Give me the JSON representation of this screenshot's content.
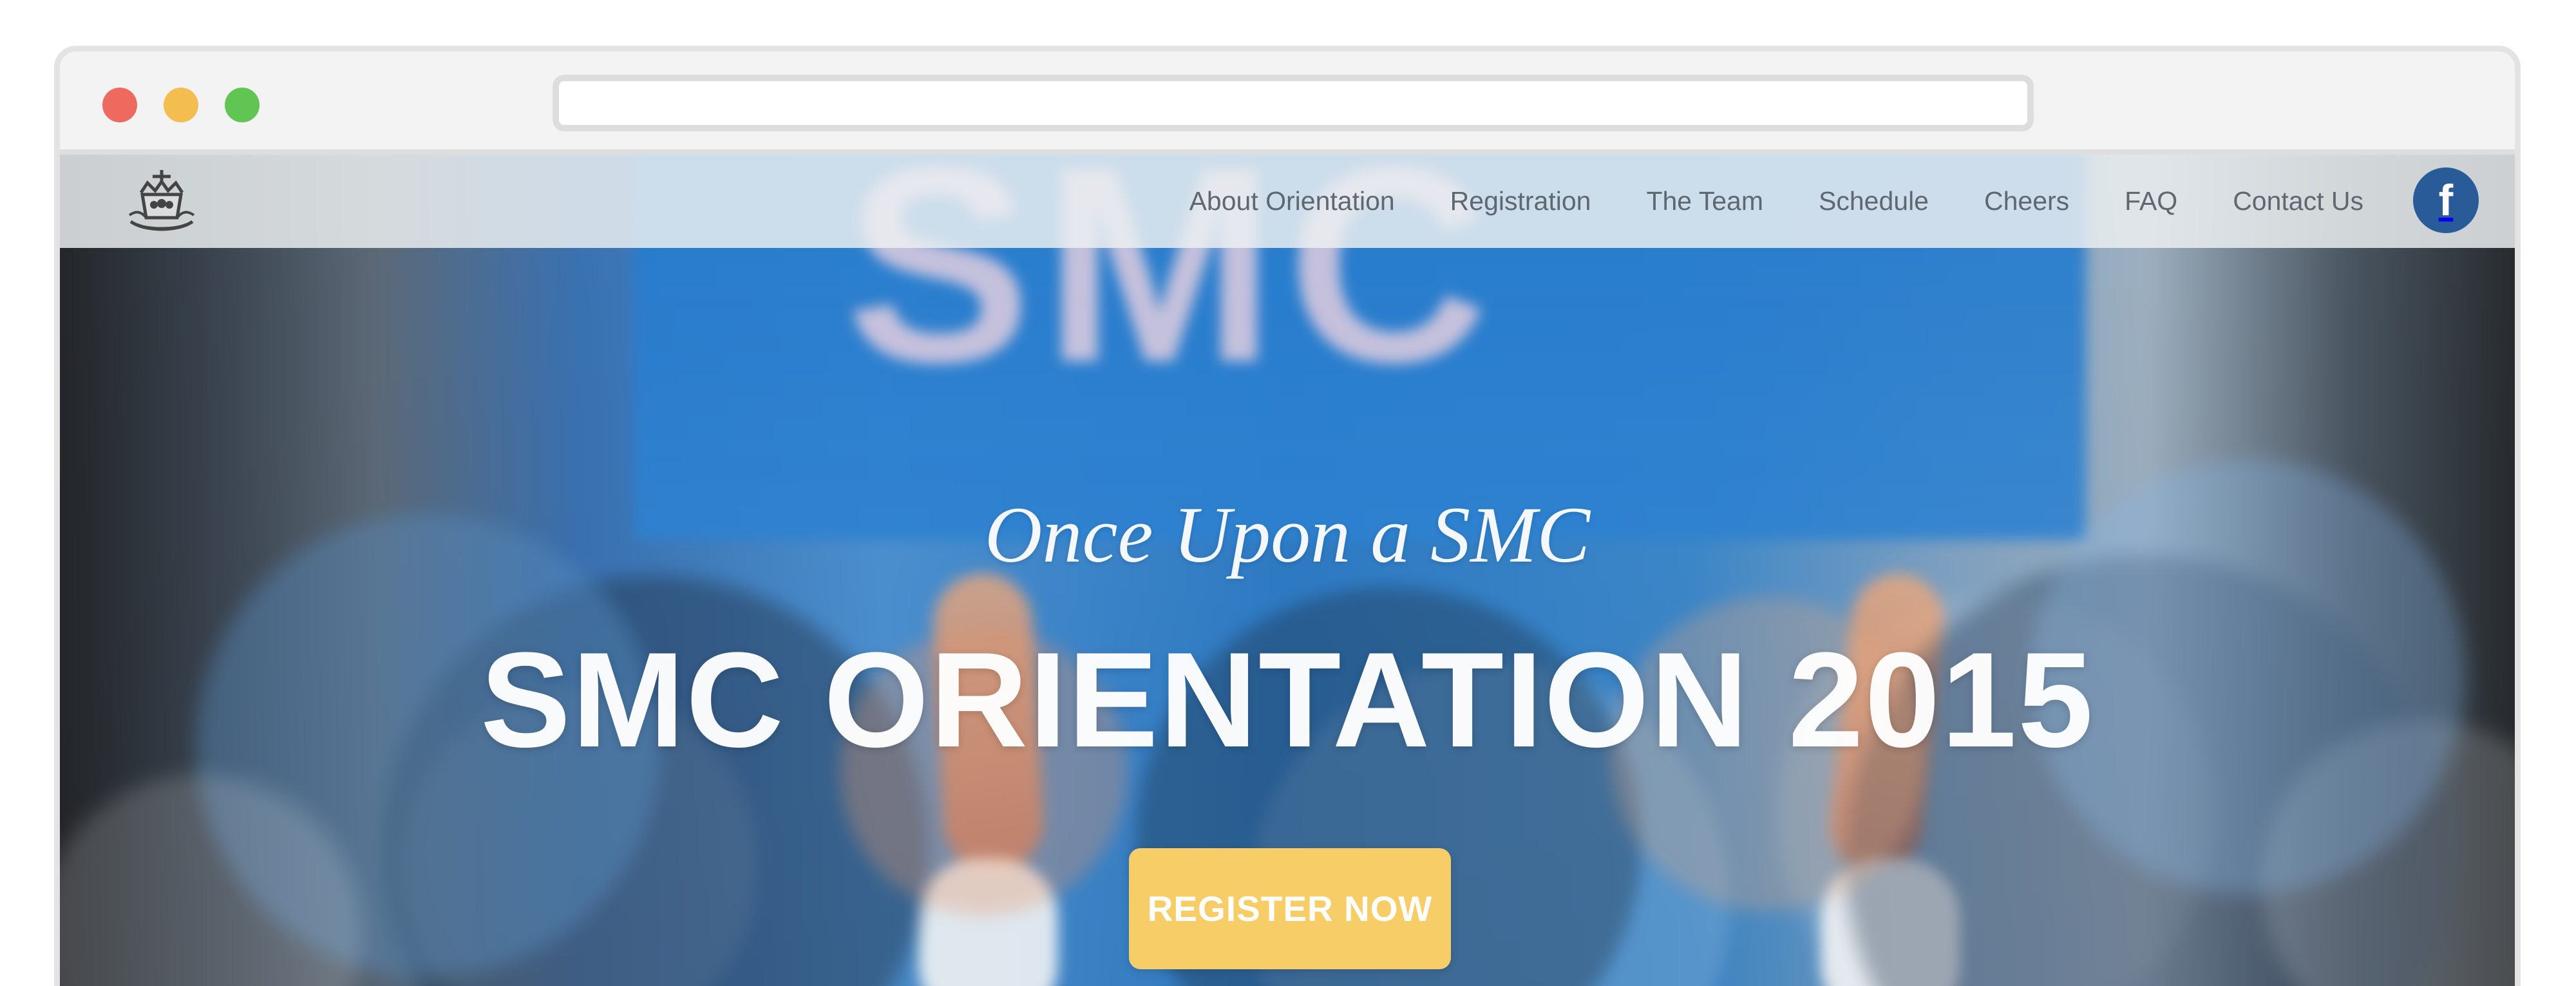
{
  "browser": {
    "address_value": ""
  },
  "nav": {
    "items": [
      {
        "label": "About Orientation"
      },
      {
        "label": "Registration"
      },
      {
        "label": "The Team"
      },
      {
        "label": "Schedule"
      },
      {
        "label": "Cheers"
      },
      {
        "label": "FAQ"
      },
      {
        "label": "Contact Us"
      }
    ],
    "facebook_icon": "facebook-icon",
    "facebook_label": "f",
    "logo_icon": "crest-logo-icon"
  },
  "hero": {
    "banner_text": "SMC",
    "subtitle": "Once Upon a SMC",
    "title": "SMC ORIENTATION 2015",
    "register_label": "REGISTER NOW"
  },
  "colors": {
    "accent_yellow": "#F7CD68",
    "facebook_blue": "#295B98",
    "nav_text": "#5F6770"
  }
}
